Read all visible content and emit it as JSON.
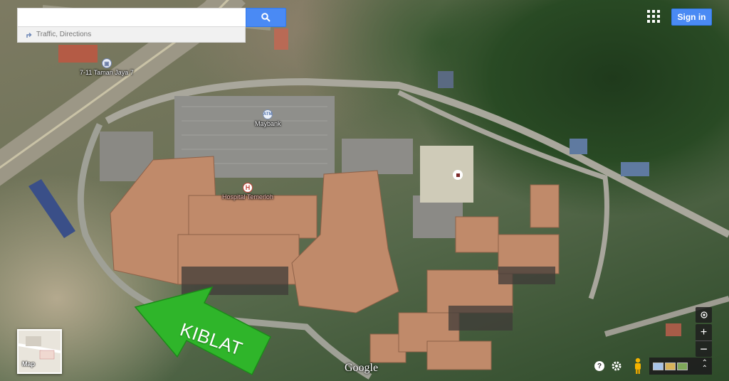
{
  "search": {
    "value": "",
    "placeholder": "",
    "button_icon": "search-icon"
  },
  "suggestion": {
    "icon": "directions-icon",
    "label": "Traffic, Directions"
  },
  "header": {
    "apps_icon": "apps-grid-icon",
    "signin_label": "Sign in"
  },
  "map": {
    "view": "satellite",
    "places": [
      {
        "name": "7-11 Taman Jaya 7",
        "icon": "shop-icon"
      },
      {
        "name": "Maybank",
        "icon": "atm-icon",
        "icon_text": "ATM"
      },
      {
        "name": "Hospital Temerloh",
        "icon": "hospital-icon",
        "icon_text": "H"
      }
    ],
    "road_shield": "",
    "annotation": {
      "text": "KIBLAT",
      "color": "#2fb52a"
    }
  },
  "maptype": {
    "label": "Map"
  },
  "attribution": {
    "logo": "Google"
  },
  "controls": {
    "locate_icon": "my-location-icon",
    "zoom_in": "+",
    "zoom_out": "−",
    "help": "?",
    "help_icon": "help-icon",
    "settings_icon": "gear-icon",
    "pegman_icon": "pegman-icon",
    "imagery_icon": "imagery-strip-icon",
    "expand_icon": "chevron-up-icon"
  },
  "colors": {
    "accent": "#4a8af4",
    "hospital": "#c4463a"
  }
}
